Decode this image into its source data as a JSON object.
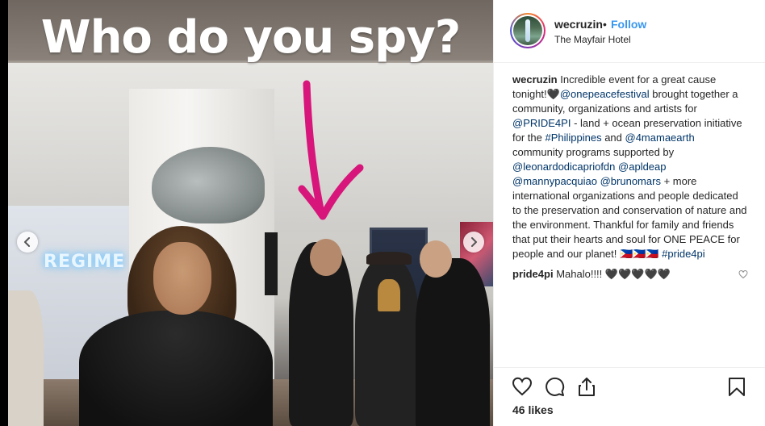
{
  "media": {
    "headline": "Who do you spy?",
    "neon_sign": "REGIME 7",
    "prev_icon": "chevron-left-icon",
    "next_icon": "chevron-right-icon",
    "arrow_color": "#d7157a"
  },
  "header": {
    "username": "wecruzin",
    "separator": "•",
    "follow_label": "Follow",
    "location": "The Mayfair Hotel"
  },
  "caption": {
    "username": "wecruzin",
    "parts": {
      "p1": " Incredible event for a great cause tonight!🖤",
      "m1": "@onepeacefestival",
      "p2": " brought together a community, organizations and artists for ",
      "m2": "@PRIDE4PI",
      "p3": " - land + ocean preservation initiative for the ",
      "h1": "#Philippines",
      "p4": " and ",
      "m3": "@4mamaearth",
      "p5": " community programs supported by ",
      "m4": "@leonardodicapriofdn",
      "p6": " ",
      "m5": "@apldeap",
      "p7": " ",
      "m6": "@mannypacquiao",
      "p8": " ",
      "m7": "@brunomars",
      "p9": " + more international organizations and people dedicated to the preservation and conservation of nature and the environment. Thankful for family and friends that put their hearts and soul for ONE PEACE for people and our planet! 🇵🇭🇵🇭🇵🇭 ",
      "h2": "#pride4pi"
    }
  },
  "comments": [
    {
      "username": "pride4pi",
      "text": " Mahalo!!!! 🖤🖤🖤🖤🖤"
    }
  ],
  "actions": {
    "like_icon": "heart-icon",
    "comment_icon": "comment-icon",
    "share_icon": "share-icon",
    "save_icon": "bookmark-icon"
  },
  "likes_label": "46 likes",
  "colors": {
    "link": "#003569",
    "follow": "#3897f0",
    "text": "#262626",
    "border": "#efefef"
  }
}
